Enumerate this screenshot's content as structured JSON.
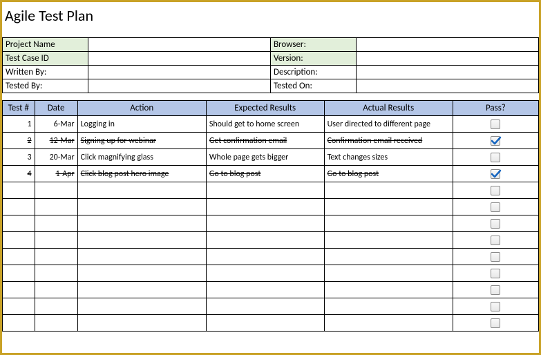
{
  "title": "Agile Test Plan",
  "meta": {
    "left": [
      {
        "label": "Project Name",
        "value": "",
        "green": true
      },
      {
        "label": "Test Case ID",
        "value": "",
        "green": true
      },
      {
        "label": "Written By:",
        "value": "",
        "green": false
      },
      {
        "label": "Tested By:",
        "value": "",
        "green": false
      }
    ],
    "right": [
      {
        "label": "Browser:",
        "value": "",
        "green": true
      },
      {
        "label": "Version:",
        "value": "",
        "green": true
      },
      {
        "label": "Description:",
        "value": "",
        "green": false
      },
      {
        "label": "Tested On:",
        "value": "",
        "green": false
      }
    ]
  },
  "columns": {
    "test": "Test #",
    "date": "Date",
    "action": "Action",
    "expected": "Expected Results",
    "actual": "Actual Results",
    "pass": "Pass?"
  },
  "rows": [
    {
      "test": "1",
      "date": "6-Mar",
      "action": "Logging in",
      "expected": "Should get to home screen",
      "actual": "User directed to different page",
      "pass": false,
      "strike": false
    },
    {
      "test": "2",
      "date": "12-Mar",
      "action": "Signing up for webinar",
      "expected": "Get confirmation email",
      "actual": "Confirmation email received",
      "pass": true,
      "strike": true
    },
    {
      "test": "3",
      "date": "20-Mar",
      "action": "Click magnifying glass",
      "expected": "Whole page gets bigger",
      "actual": "Text changes sizes",
      "pass": false,
      "strike": false
    },
    {
      "test": "4",
      "date": "1-Apr",
      "action": "Click blog post hero image",
      "expected": "Go to blog post",
      "actual": "Go to blog post",
      "pass": true,
      "strike": true
    },
    {
      "test": "",
      "date": "",
      "action": "",
      "expected": "",
      "actual": "",
      "pass": false,
      "strike": false
    },
    {
      "test": "",
      "date": "",
      "action": "",
      "expected": "",
      "actual": "",
      "pass": false,
      "strike": false
    },
    {
      "test": "",
      "date": "",
      "action": "",
      "expected": "",
      "actual": "",
      "pass": false,
      "strike": false
    },
    {
      "test": "",
      "date": "",
      "action": "",
      "expected": "",
      "actual": "",
      "pass": false,
      "strike": false
    },
    {
      "test": "",
      "date": "",
      "action": "",
      "expected": "",
      "actual": "",
      "pass": false,
      "strike": false
    },
    {
      "test": "",
      "date": "",
      "action": "",
      "expected": "",
      "actual": "",
      "pass": false,
      "strike": false
    },
    {
      "test": "",
      "date": "",
      "action": "",
      "expected": "",
      "actual": "",
      "pass": false,
      "strike": false
    },
    {
      "test": "",
      "date": "",
      "action": "",
      "expected": "",
      "actual": "",
      "pass": false,
      "strike": false
    },
    {
      "test": "",
      "date": "",
      "action": "",
      "expected": "",
      "actual": "",
      "pass": false,
      "strike": false
    }
  ]
}
